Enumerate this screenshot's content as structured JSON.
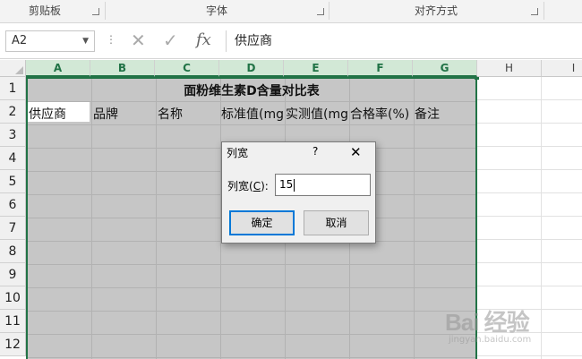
{
  "ribbon": {
    "groups": [
      "剪贴板",
      "字体",
      "对齐方式"
    ]
  },
  "formula_bar": {
    "name_box": "A2",
    "cancel_icon": "✕",
    "enter_icon": "✓",
    "fx_label": "fx",
    "content": "供应商"
  },
  "sheet": {
    "columns": [
      "A",
      "B",
      "C",
      "D",
      "E",
      "F",
      "G",
      "H",
      "I"
    ],
    "rows": [
      "1",
      "2",
      "3",
      "4",
      "5",
      "6",
      "7",
      "8",
      "9",
      "10",
      "11",
      "12"
    ],
    "title": "面粉维生素D含量对比表",
    "headers": [
      "供应商",
      "品牌",
      "名称",
      "标准值(mg",
      "实测值(mg",
      "合格率(%)",
      "备注"
    ]
  },
  "dialog": {
    "title": "列宽",
    "help": "?",
    "close": "✕",
    "label": "列宽(",
    "label_key": "C",
    "label_end": "):",
    "value": "15",
    "ok_label": "确定",
    "cancel_label": "取消"
  },
  "watermark": {
    "main": "Bai 经验",
    "sub": "jingyan.baidu.com"
  },
  "colors": {
    "accent": "#217346",
    "dialog_default": "#0078d7",
    "selection_fill": "#c6c6c6"
  }
}
